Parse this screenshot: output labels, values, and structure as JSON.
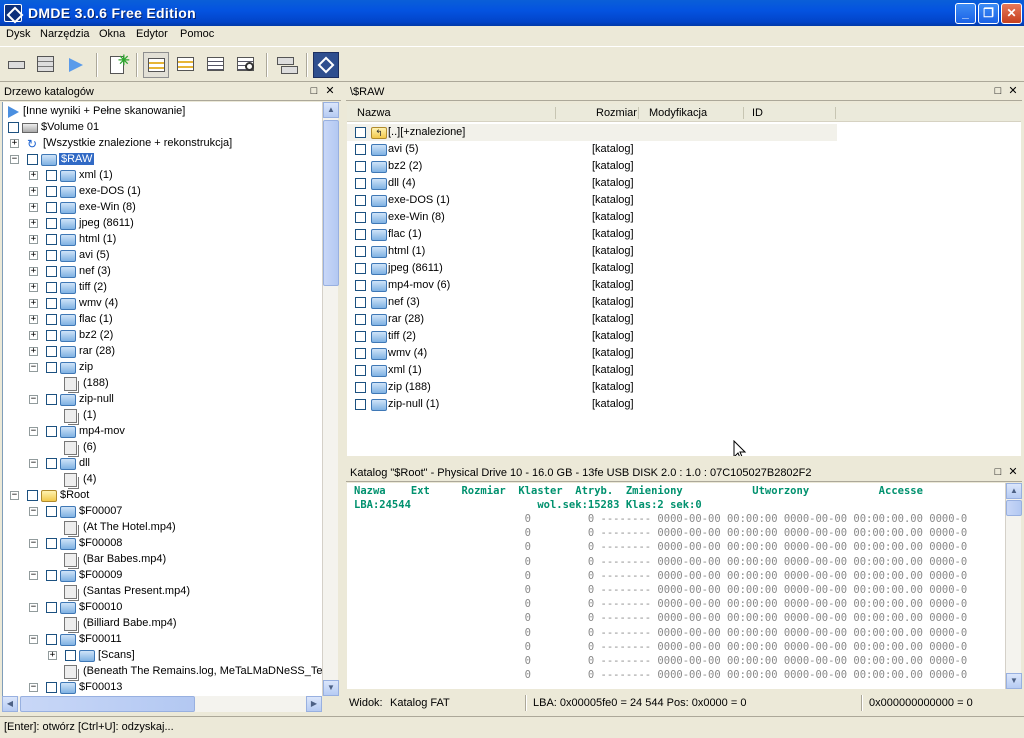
{
  "window": {
    "title": "DMDE 3.0.6 Free Edition"
  },
  "menu": [
    "Dysk",
    "Narzędzia",
    "Okna",
    "Edytor",
    "Pomoc"
  ],
  "toolbar_icons": [
    "drive-icon",
    "partitions-icon",
    "play-icon",
    "new-icon",
    "tree-view-icon",
    "list-view-icon",
    "details-view-icon",
    "search-view-icon",
    "copy-icon",
    "dmde-logo-icon"
  ],
  "tree_panel": {
    "title": "Drzewo katalogów",
    "rows": [
      {
        "label": "[Inne wyniki + Pełne skanowanie]"
      },
      {
        "label": "$Volume 01"
      },
      {
        "label": "[Wszystkie znalezione + rekonstrukcja]"
      },
      {
        "label": "$RAW"
      },
      {
        "label": "xml (1)"
      },
      {
        "label": "exe-DOS (1)"
      },
      {
        "label": "exe-Win (8)"
      },
      {
        "label": "jpeg (8611)"
      },
      {
        "label": "html (1)"
      },
      {
        "label": "avi (5)"
      },
      {
        "label": "nef (3)"
      },
      {
        "label": "tiff (2)"
      },
      {
        "label": "wmv (4)"
      },
      {
        "label": "flac (1)"
      },
      {
        "label": "bz2 (2)"
      },
      {
        "label": "rar (28)"
      },
      {
        "label": "zip"
      },
      {
        "label": "(188)"
      },
      {
        "label": "zip-null"
      },
      {
        "label": "(1)"
      },
      {
        "label": "mp4-mov"
      },
      {
        "label": "(6)"
      },
      {
        "label": "dll"
      },
      {
        "label": "(4)"
      },
      {
        "label": "$Root"
      },
      {
        "label": "$F00007"
      },
      {
        "label": "(At The Hotel.mp4)"
      },
      {
        "label": "$F00008"
      },
      {
        "label": "(Bar Babes.mp4)"
      },
      {
        "label": "$F00009"
      },
      {
        "label": "(Santas Present.mp4)"
      },
      {
        "label": "$F00010"
      },
      {
        "label": "(Billiard Babe.mp4)"
      },
      {
        "label": "$F00011"
      },
      {
        "label": "[Scans]"
      },
      {
        "label": "(Beneath The Remains.log, MeTaLMaDNeSS_TeaN"
      },
      {
        "label": "$F00013"
      }
    ]
  },
  "list_panel": {
    "title": "\\$RAW",
    "columns": [
      "Nazwa",
      "Rozmiar",
      "Modyfikacja",
      "ID"
    ],
    "rows": [
      {
        "name": "[..][+znalezione]",
        "size": ""
      },
      {
        "name": "avi (5)",
        "size": "[katalog]"
      },
      {
        "name": "bz2 (2)",
        "size": "[katalog]"
      },
      {
        "name": "dll (4)",
        "size": "[katalog]"
      },
      {
        "name": "exe-DOS (1)",
        "size": "[katalog]"
      },
      {
        "name": "exe-Win (8)",
        "size": "[katalog]"
      },
      {
        "name": "flac (1)",
        "size": "[katalog]"
      },
      {
        "name": "html (1)",
        "size": "[katalog]"
      },
      {
        "name": "jpeg (8611)",
        "size": "[katalog]"
      },
      {
        "name": "mp4-mov (6)",
        "size": "[katalog]"
      },
      {
        "name": "nef (3)",
        "size": "[katalog]"
      },
      {
        "name": "rar (28)",
        "size": "[katalog]"
      },
      {
        "name": "tiff (2)",
        "size": "[katalog]"
      },
      {
        "name": "wmv (4)",
        "size": "[katalog]"
      },
      {
        "name": "xml (1)",
        "size": "[katalog]"
      },
      {
        "name": "zip (188)",
        "size": "[katalog]"
      },
      {
        "name": "zip-null (1)",
        "size": "[katalog]"
      }
    ]
  },
  "fat_panel": {
    "title": "Katalog \"$Root\" - Physical Drive 10 - 16.0 GB - 13fe USB DISK 2.0 : 1.0 : 07C105027B2802F2",
    "header": "Nazwa    Ext     Rozmiar  Klaster  Atryb.  Zmieniony           Utworzony           Accesse",
    "lba_line": "LBA:24544                    wol.sek:15283 Klas:2 sek:0",
    "data_line": "                           0         0 -------- 0000-00-00 00:00:00 0000-00-00 00:00:00.00 0000-0",
    "data_line_count": 12,
    "status": {
      "view": "Widok:",
      "view_value": "Katalog FAT",
      "lba": "LBA: 0x00005fe0 = 24 544  Pos: 0x0000 = 0",
      "offset": "0x000000000000 = 0"
    }
  },
  "statusbar": {
    "text": "[Enter]: otwórz  [Ctrl+U]: odzyskaj..."
  }
}
